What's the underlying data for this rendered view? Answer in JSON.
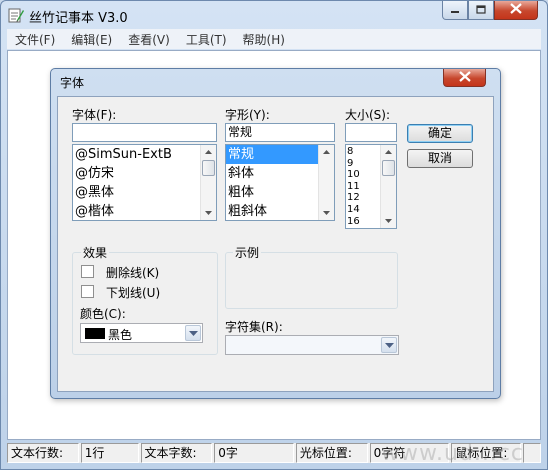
{
  "window": {
    "title": "丝竹记事本 V3.0"
  },
  "menu": [
    "文件(F)",
    "编辑(E)",
    "查看(V)",
    "工具(T)",
    "帮助(H)"
  ],
  "dialog": {
    "title": "字体",
    "font_label": "字体(F):",
    "font_value": "",
    "font_list": [
      "@SimSun-ExtB",
      "@仿宋",
      "@黑体",
      "@楷体"
    ],
    "style_label": "字形(Y):",
    "style_value": "常规",
    "style_list": [
      "常规",
      "斜体",
      "粗体",
      "粗斜体"
    ],
    "style_selected_index": 0,
    "size_label": "大小(S):",
    "size_value": "",
    "size_list": [
      "8",
      "9",
      "10",
      "11",
      "12",
      "14",
      "16"
    ],
    "ok_label": "确定",
    "cancel_label": "取消",
    "effects_group": "效果",
    "strikeout_label": "删除线(K)",
    "underline_label": "下划线(U)",
    "color_label": "颜色(C):",
    "color_value": "黑色",
    "color_swatch": "#000000",
    "sample_group": "示例",
    "charset_label": "字符集(R):",
    "charset_value": ""
  },
  "status": {
    "lines_label": "文本行数:",
    "lines_value": "1行",
    "chars_label": "文本字数:",
    "chars_value": "0字",
    "cursor_label": "光标位置:",
    "cursor_value": "0字符",
    "cursor2_label": "鼠标位置:"
  },
  "watermark": "www.ud...cc",
  "colors": {
    "close_red": "#c7472d",
    "selection_blue": "#3399ff",
    "frame_blue": "#bed2e9"
  }
}
